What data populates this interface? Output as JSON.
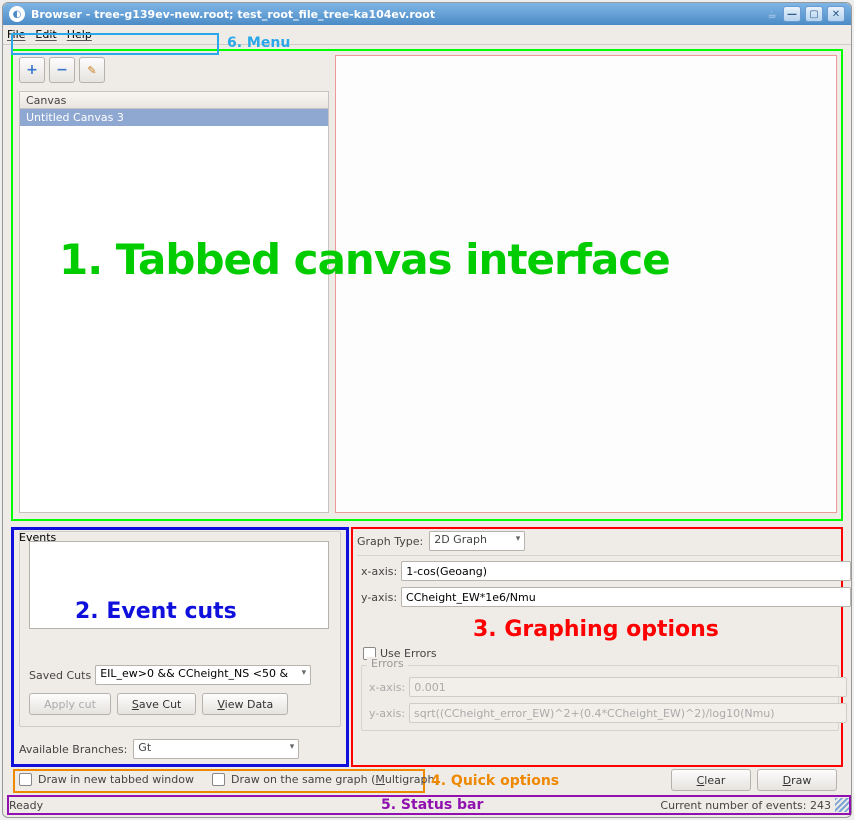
{
  "window": {
    "title": "Browser - tree-g139ev-new.root; test_root_file_tree-ka104ev.root"
  },
  "menu": {
    "file": "File",
    "edit": "Edit",
    "help": "Help"
  },
  "annot": {
    "menu": "6. Menu",
    "canvas": "1. Tabbed canvas interface",
    "events": "2. Event cuts",
    "graph": "3. Graphing options",
    "quick": "4. Quick options",
    "status": "5. Status bar"
  },
  "canvas": {
    "header": "Canvas",
    "items": [
      "Untitled Canvas 3"
    ]
  },
  "events": {
    "legend": "Events",
    "saved_cuts_label": "Saved Cuts",
    "saved_cuts_value": "EIL_ew>0 && CCheight_NS <50 &",
    "apply_cut": "Apply cut",
    "save_cut": "Save Cut",
    "view_data": "View Data",
    "avail_label": "Available Branches:",
    "avail_value": "Gt"
  },
  "graph": {
    "type_label": "Graph Type:",
    "type_value": "2D Graph",
    "xaxis_label": "x-axis:",
    "xaxis_value": "1-cos(Geoang)",
    "yaxis_label": "y-axis:",
    "yaxis_value": "CCheight_EW*1e6/Nmu",
    "use_errors": "Use Errors",
    "errors_legend": "Errors",
    "err_x_label": "x-axis:",
    "err_x_value": "0.001",
    "err_y_label": "y-axis:",
    "err_y_value": "sqrt((CCheight_error_EW)^2+(0.4*CCheight_EW)^2)/log10(Nmu)"
  },
  "quick": {
    "new_window": "Draw in new tabbed window",
    "multigraph": "Draw on the same graph (Multigraph)"
  },
  "actions": {
    "clear": "Clear",
    "draw": "Draw"
  },
  "status": {
    "ready": "Ready",
    "events": "Current number of events: 243"
  }
}
